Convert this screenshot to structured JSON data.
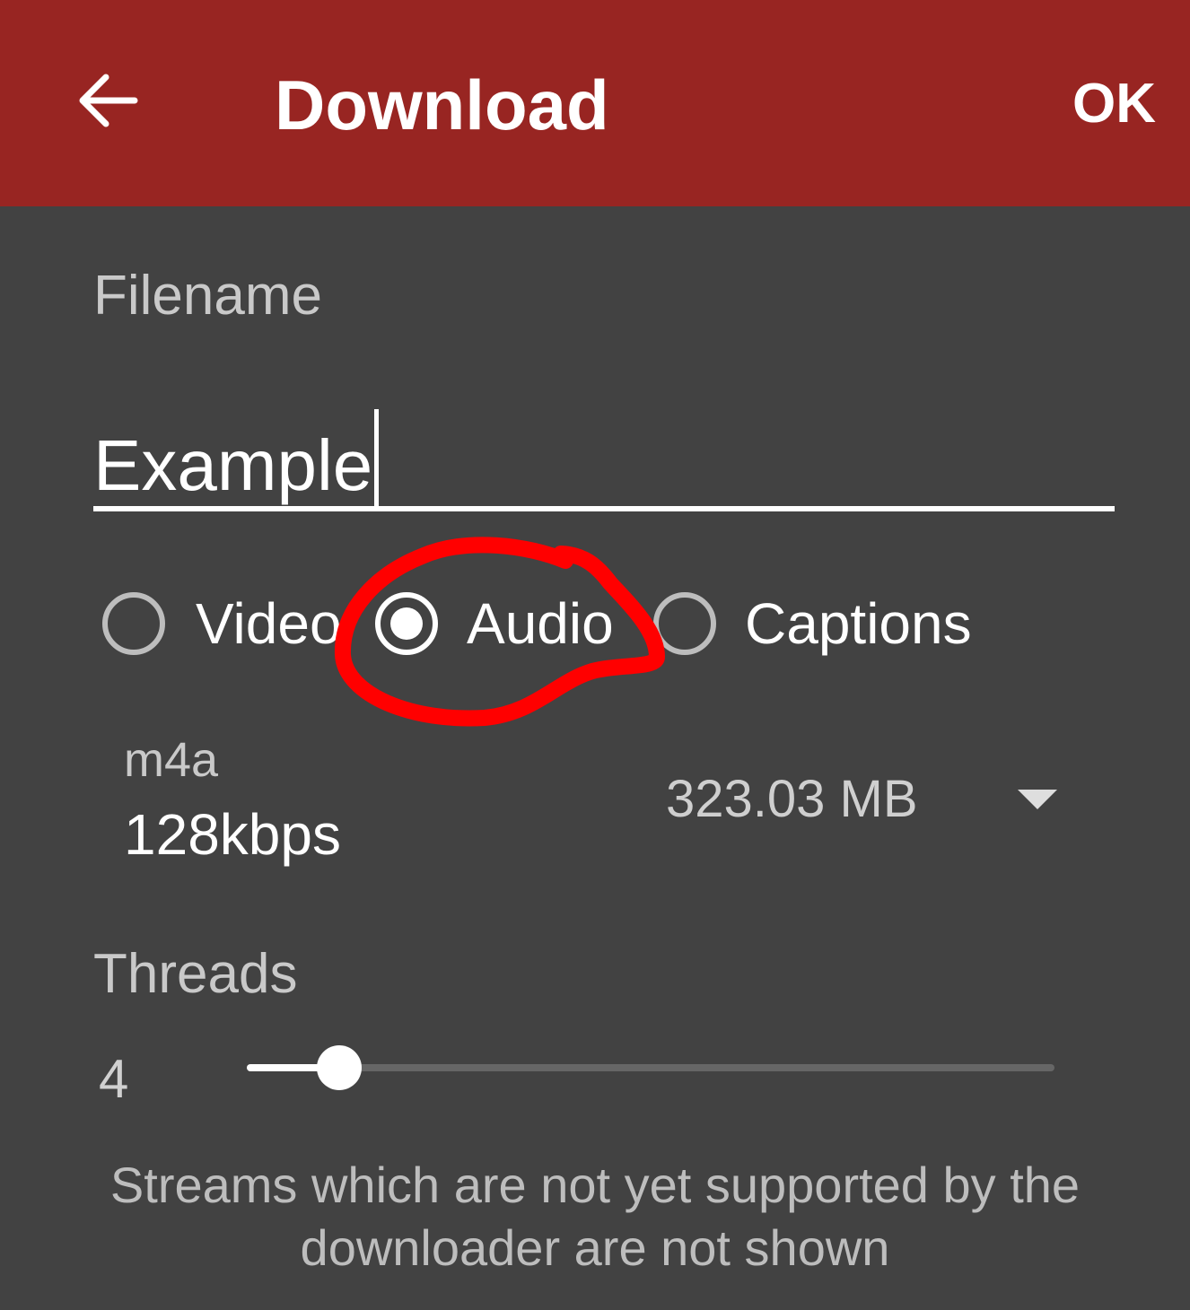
{
  "toolbar": {
    "back_icon": "arrow-back-icon",
    "title": "Download",
    "ok_label": "OK",
    "color": "#982522"
  },
  "filename": {
    "label": "Filename",
    "value": "Example"
  },
  "stream_type": {
    "options": [
      {
        "label": "Video",
        "checked": false
      },
      {
        "label": "Audio",
        "checked": true
      },
      {
        "label": "Captions",
        "checked": false
      }
    ],
    "annotation": "red-hand-drawn-circle around Audio option"
  },
  "stream": {
    "format": "m4a",
    "quality": "128kbps",
    "size": "323.03 MB",
    "dropdown_icon": "dropdown-arrow-icon"
  },
  "threads": {
    "label": "Threads",
    "value": "4",
    "min": 1,
    "max": 32,
    "level": 4
  },
  "footer": {
    "line1": "Streams which are not yet supported by the",
    "line2": "downloader are not shown"
  },
  "colors": {
    "background": "#424242",
    "annotation": "#ff0000"
  }
}
